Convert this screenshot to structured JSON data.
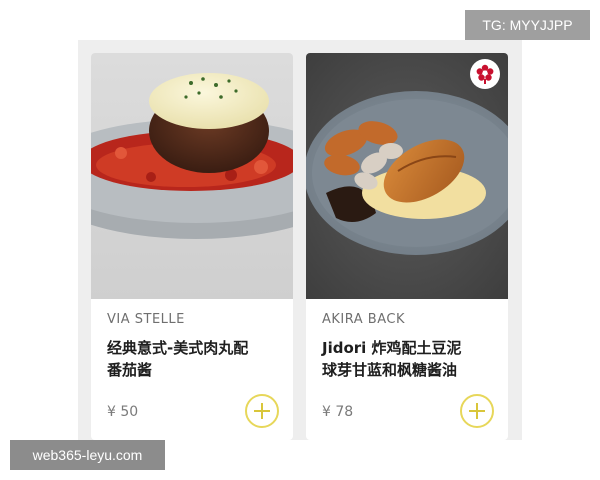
{
  "watermarks": {
    "top_right": "TG: MYYJJPP",
    "bottom_left": "web365-leyu.com"
  },
  "menu_items": [
    {
      "restaurant": "VIA STELLE",
      "dish_line_1": "经典意式-美式肉丸配",
      "dish_line_2": "番茄酱",
      "price": "¥ 50",
      "add_icon": "plus-icon",
      "accent_color": "#e7d75a"
    },
    {
      "restaurant": "AKIRA BACK",
      "dish_line_1": "Jidori 炸鸡配土豆泥",
      "dish_line_2": "球芽甘蓝和枫糖酱油",
      "price": "¥ 78",
      "add_icon": "plus-icon",
      "badge_icon": "michelin-star-icon",
      "accent_color": "#e7d75a"
    }
  ]
}
